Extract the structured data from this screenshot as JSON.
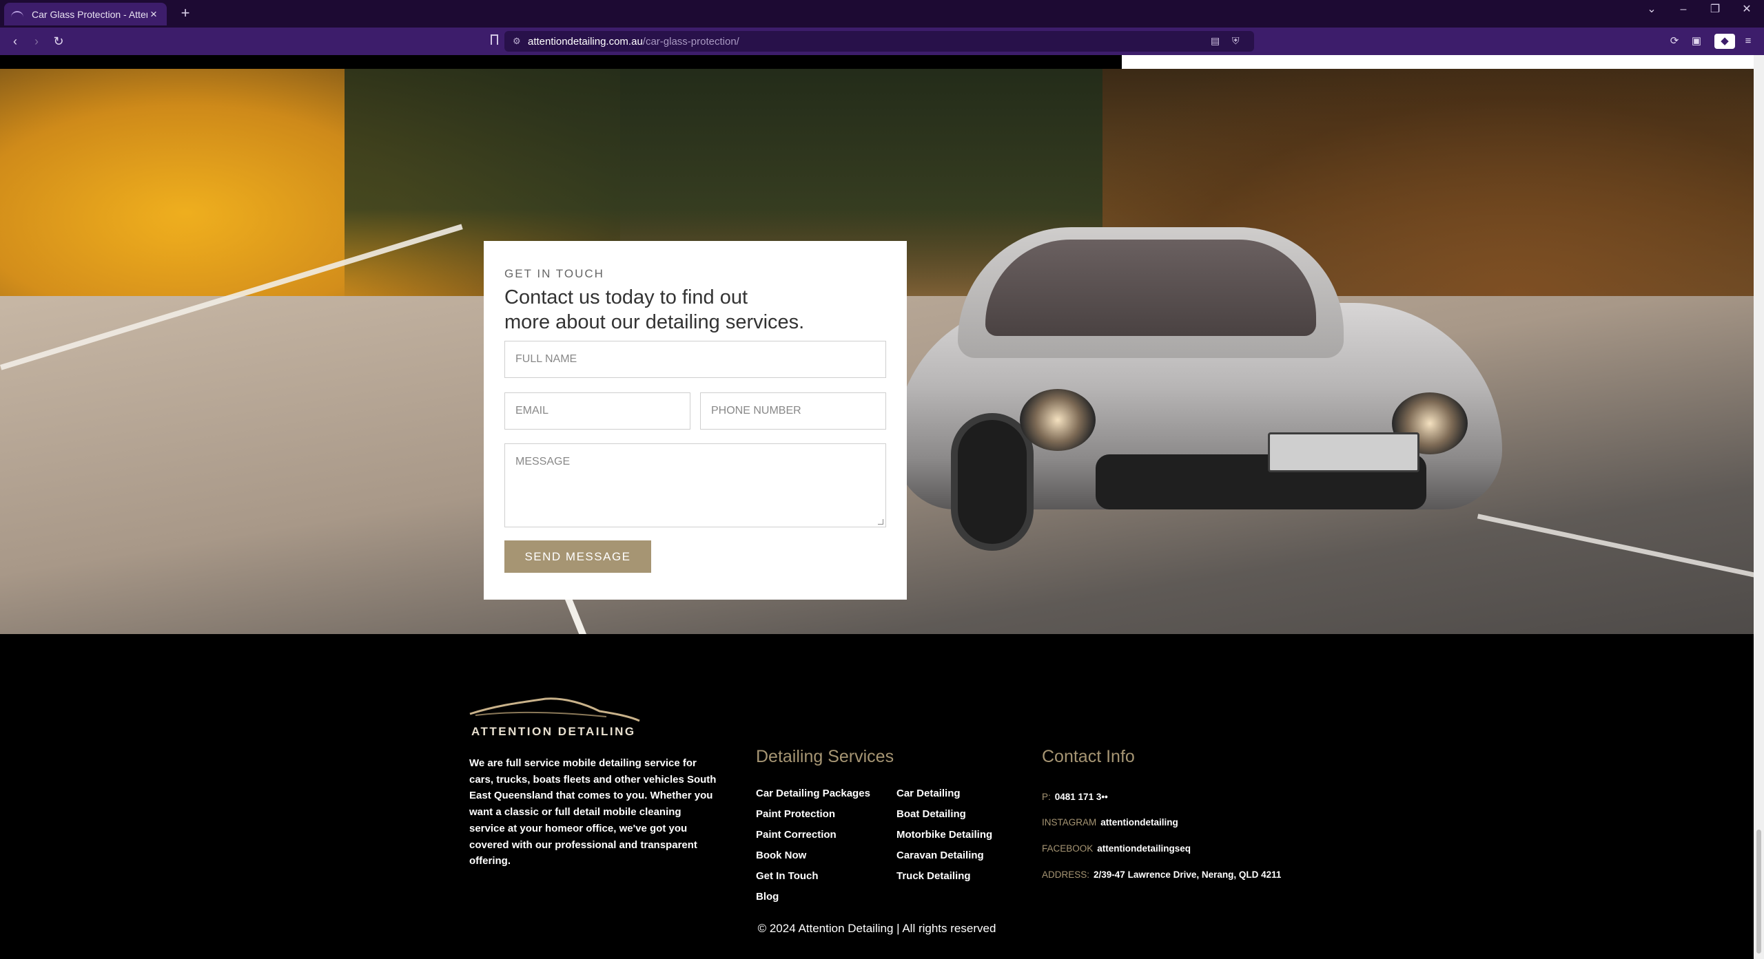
{
  "browser": {
    "tab_title": "Car Glass Protection - Attention",
    "url_domain": "attentiondetailing.com.au",
    "url_path": "/car-glass-protection/"
  },
  "contact_form": {
    "eyebrow": "GET IN TOUCH",
    "heading_line1": "Contact us today to find out",
    "heading_line2": "more about our detailing services.",
    "full_name_placeholder": "FULL NAME",
    "email_placeholder": "EMAIL",
    "phone_placeholder": "PHONE NUMBER",
    "message_placeholder": "MESSAGE",
    "send_label": "SEND MESSAGE"
  },
  "footer": {
    "logo_text": "ATTENTION DETAILING",
    "about": "We are full service mobile detailing service for cars, trucks, boats fleets and other vehicles South East Queensland that comes to you. Whether you want a classic or full detail mobile cleaning service at your homeor office, we've got you covered with our professional and transparent offering.",
    "services_heading": "Detailing Services",
    "services_col1": [
      "Car Detailing Packages",
      "Paint Protection",
      "Paint Correction",
      "Book Now",
      "Get In Touch",
      "Blog"
    ],
    "services_col2": [
      "Car Detailing",
      "Boat Detailing",
      "Motorbike Detailing",
      "Caravan Detailing",
      "Truck Detailing"
    ],
    "contact_heading": "Contact Info",
    "phone_label": "P:",
    "phone_value": "0481 171 3••",
    "instagram_label": "INSTAGRAM",
    "instagram_value": "attentiondetailing",
    "facebook_label": "FACEBOOK",
    "facebook_value": "attentiondetailingseq",
    "address_label": "ADDRESS:",
    "address_value": "2/39-47 Lawrence Drive, Nerang, QLD 4211",
    "copyright": "© 2024 Attention Detailing | All rights reserved"
  },
  "colors": {
    "accent": "#a69573",
    "tabbar": "#1d0a33",
    "toolbar": "#3d1d6b"
  }
}
